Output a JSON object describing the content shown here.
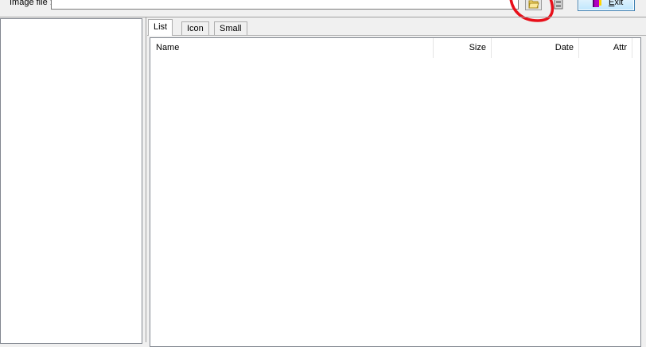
{
  "toolbar": {
    "image_label": "Image file :",
    "image_value": "",
    "exit_label": "Exit"
  },
  "tabs": [
    {
      "label": "List",
      "selected": true
    },
    {
      "label": "Icon",
      "selected": false
    },
    {
      "label": "Small",
      "selected": false
    }
  ],
  "file_list": {
    "columns": [
      "Name",
      "Size",
      "Date",
      "Attr"
    ],
    "rows": []
  },
  "colors": {
    "annotation": "#e8101a",
    "exit_border": "#3c7fb1"
  }
}
